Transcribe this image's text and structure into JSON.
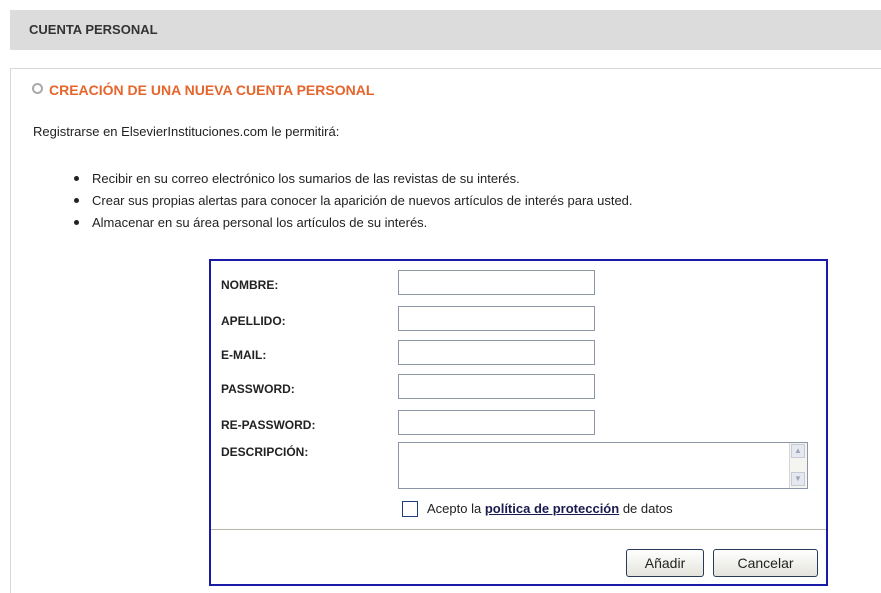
{
  "header": {
    "title": "CUENTA PERSONAL"
  },
  "section": {
    "title": "CREACIÓN DE UNA NUEVA CUENTA PERSONAL"
  },
  "intro": "Registrarse en ElsevierInstituciones.com le permitirá:",
  "benefits": [
    "Recibir en su correo electrónico los sumarios de las revistas de su interés.",
    "Crear sus propias alertas para conocer la aparición de nuevos artículos de interés para usted.",
    "Almacenar en su área personal los artículos de su interés."
  ],
  "form": {
    "fields": {
      "nombre": {
        "label": "NOMBRE:",
        "value": ""
      },
      "apellido": {
        "label": "APELLIDO:",
        "value": ""
      },
      "email": {
        "label": "E-MAIL:",
        "value": ""
      },
      "password": {
        "label": "PASSWORD:",
        "value": ""
      },
      "repassword": {
        "label": "RE-PASSWORD:",
        "value": ""
      },
      "descripcion": {
        "label": "DESCRIPCIÓN:",
        "value": ""
      }
    },
    "accept": {
      "prefix": "Acepto la",
      "link": "política de protección",
      "suffix": "de datos",
      "checked": false
    },
    "buttons": {
      "add": "Añadir",
      "cancel": "Cancelar"
    }
  },
  "colors": {
    "accent": "#e5652c",
    "form_border": "#1a1aa8",
    "header_bg": "#dcdcdc"
  }
}
